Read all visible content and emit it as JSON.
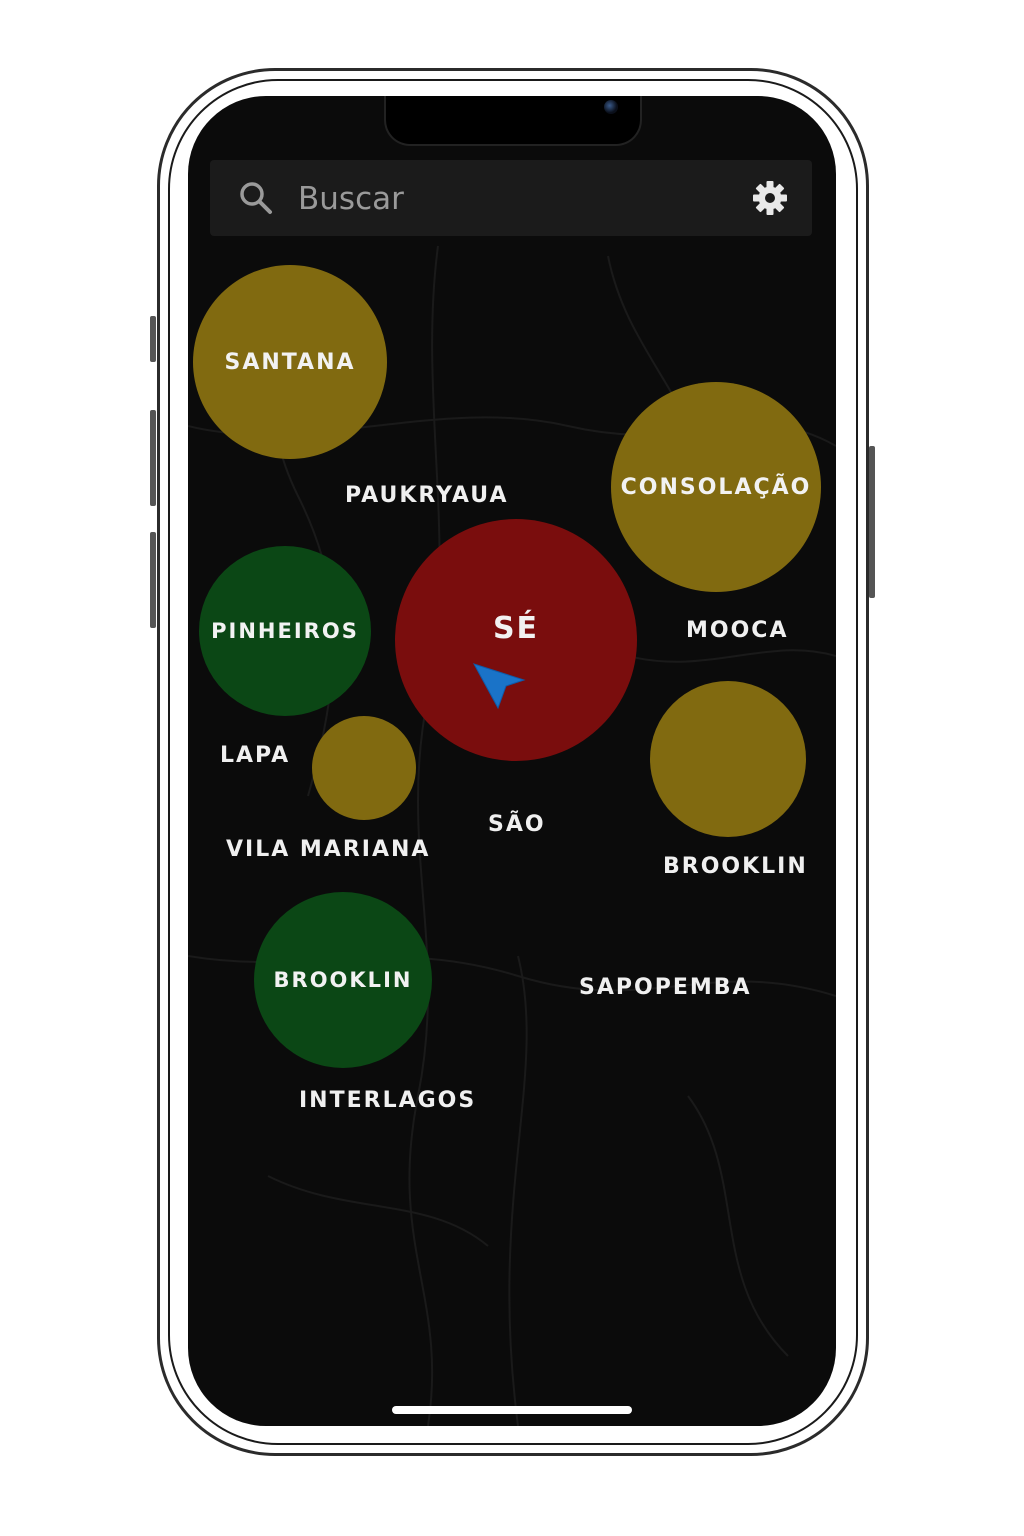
{
  "search": {
    "placeholder": "Buscar"
  },
  "colors": {
    "high": "#7a0d0d",
    "medium": "#816a10",
    "low": "#0b4715",
    "location_arrow": "#1a73c8"
  },
  "bubbles": [
    {
      "id": "santana",
      "label": "SANTANA",
      "level": "medium"
    },
    {
      "id": "consolacao",
      "label": "CONSOLAÇÃO",
      "level": "medium"
    },
    {
      "id": "pinheiros",
      "label": "PINHEIROS",
      "level": "low"
    },
    {
      "id": "se",
      "label": "SÉ",
      "level": "high"
    },
    {
      "id": "small-unlabeled",
      "label": "",
      "level": "medium"
    },
    {
      "id": "east-unlabeled",
      "label": "",
      "level": "medium"
    },
    {
      "id": "brooklin-green",
      "label": "BROOKLIN",
      "level": "low"
    }
  ],
  "labels": {
    "paukryaua": "PAUKRYAUA",
    "mooca": "MOOCA",
    "lapa": "LAPA",
    "vila_mariana": "VILA MARIANA",
    "sao": "SÃO",
    "brooklin": "BROOKLIN",
    "sapopemba": "SAPOPEMBA",
    "interlagos": "INTERLAGOS"
  }
}
